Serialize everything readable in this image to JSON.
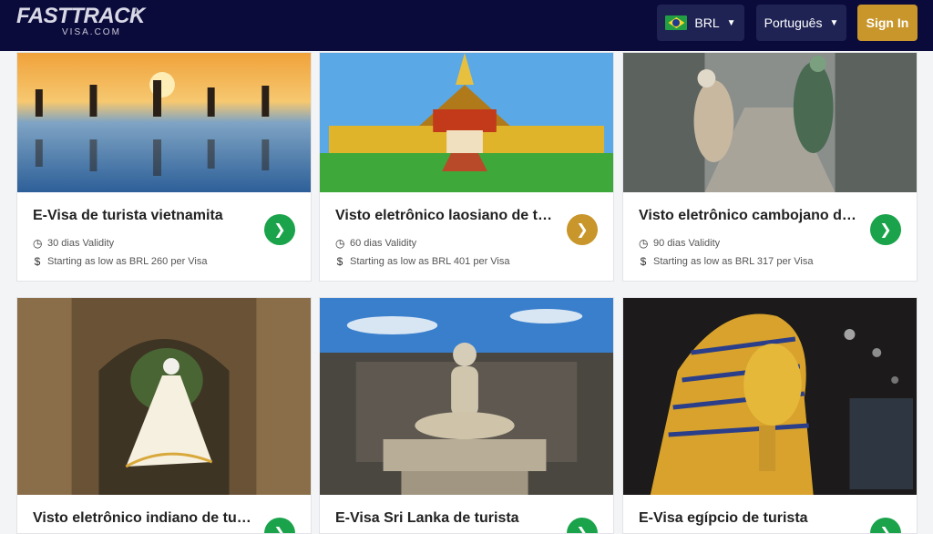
{
  "header": {
    "logo_text": "FASTTRACK",
    "logo_sub": "VISA.COM",
    "currency": "BRL",
    "language": "Português",
    "signin": "Sign In"
  },
  "cards": [
    {
      "title": "E-Visa de turista vietnamita",
      "validity": "30 dias Validity",
      "price": "Starting as low as BRL 260 per Visa",
      "button_color": "#1aa34a"
    },
    {
      "title": "Visto eletrônico laosiano de turista",
      "validity": "60 dias Validity",
      "price": "Starting as low as BRL 401 per Visa",
      "button_color": "#c8962a"
    },
    {
      "title": "Visto eletrônico cambojano de turista",
      "validity": "90 dias Validity",
      "price": "Starting as low as BRL 317 per Visa",
      "button_color": "#1aa34a"
    },
    {
      "title": "Visto eletrônico indiano de turista",
      "button_color": "#1aa34a"
    },
    {
      "title": "E-Visa Sri Lanka de turista",
      "button_color": "#1aa34a"
    },
    {
      "title": "E-Visa egípcio de turista",
      "button_color": "#1aa34a"
    }
  ]
}
